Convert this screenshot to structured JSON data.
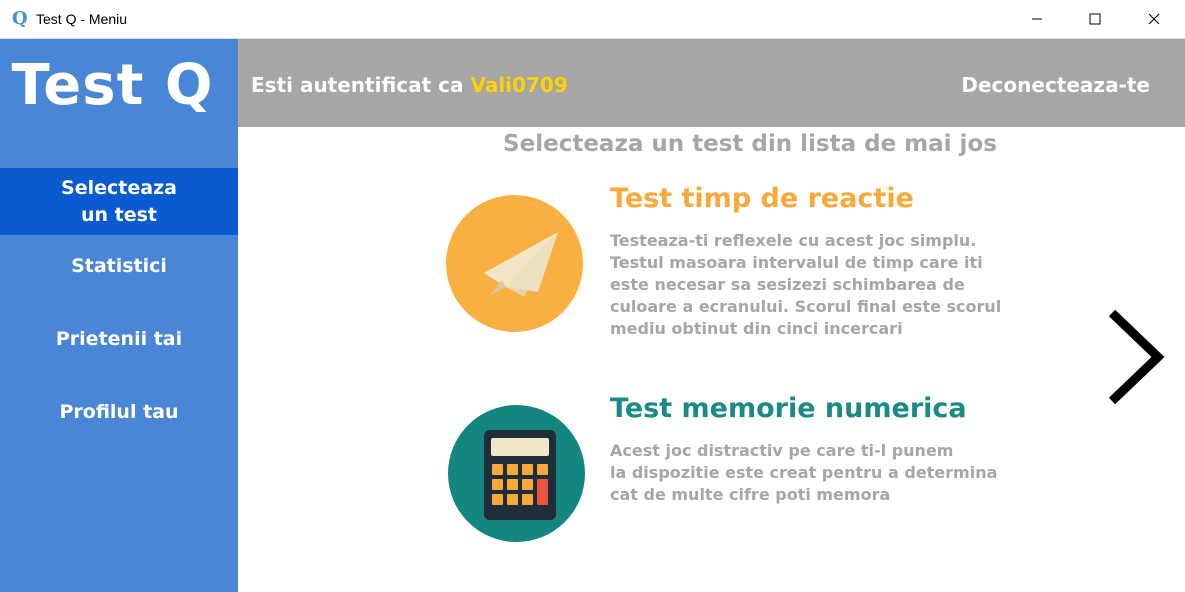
{
  "window": {
    "app_icon_glyph": "Q",
    "title": "Test Q - Meniu",
    "controls": [
      "minimize-icon",
      "maximize-icon",
      "close-icon"
    ]
  },
  "sidebar": {
    "logo": "Test Q",
    "items": [
      {
        "label_line1": "Selecteaza",
        "label_line2": "un test",
        "active": true
      },
      {
        "label": "Statistici"
      },
      {
        "label": "Prietenii tai"
      },
      {
        "label": "Profilul tau"
      }
    ]
  },
  "header": {
    "auth_prefix": "Esti autentificat ca",
    "username": "Vali0709",
    "logout": "Deconecteaza-te"
  },
  "main": {
    "subtitle": "Selecteaza un test din lista de mai jos",
    "tests": [
      {
        "title": "Test timp de reactie",
        "title_color": "#f9a93a",
        "icon": "paper-plane-icon",
        "icon_bg": "#f9b040",
        "description": [
          "Testeaza-ti reflexele cu acest joc simplu.",
          "Testul masoara intervalul de timp care iti",
          "este necesar sa sesizezi schimbarea de",
          "culoare a ecranului. Scorul final este scorul",
          "mediu obtinut din cinci incercari"
        ]
      },
      {
        "title": "Test memorie numerica",
        "title_color": "#1a8a86",
        "icon": "calculator-icon",
        "icon_bg": "#13877f",
        "description": [
          "Acest joc distractiv pe care ti-l punem",
          "la dispozitie este creat pentru a determina",
          "cat de multe cifre poti memora"
        ]
      }
    ],
    "next_icon": "chevron-right-icon"
  },
  "colors": {
    "sidebar": "#4a86d6",
    "sidebar_active": "#0a5bd0",
    "header": "#a6a6a6",
    "username": "#ffd200"
  }
}
